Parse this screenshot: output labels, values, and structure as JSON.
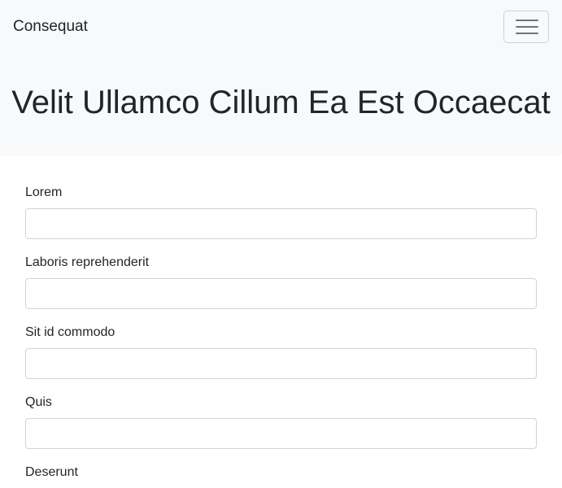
{
  "navbar": {
    "brand": "Consequat",
    "toggler_icon": "hamburger-menu-icon"
  },
  "jumbotron": {
    "title": "Velit Ullamco Cillum Ea Est Occaecat"
  },
  "form": {
    "fields": [
      {
        "label": "Lorem",
        "value": ""
      },
      {
        "label": "Laboris reprehenderit",
        "value": ""
      },
      {
        "label": "Sit id commodo",
        "value": ""
      },
      {
        "label": "Quis",
        "value": ""
      },
      {
        "label": "Deserunt",
        "value": ""
      }
    ]
  },
  "colors": {
    "navbar_bg": "#f8f9fa",
    "text": "#212529",
    "input_border": "#ced4da"
  }
}
